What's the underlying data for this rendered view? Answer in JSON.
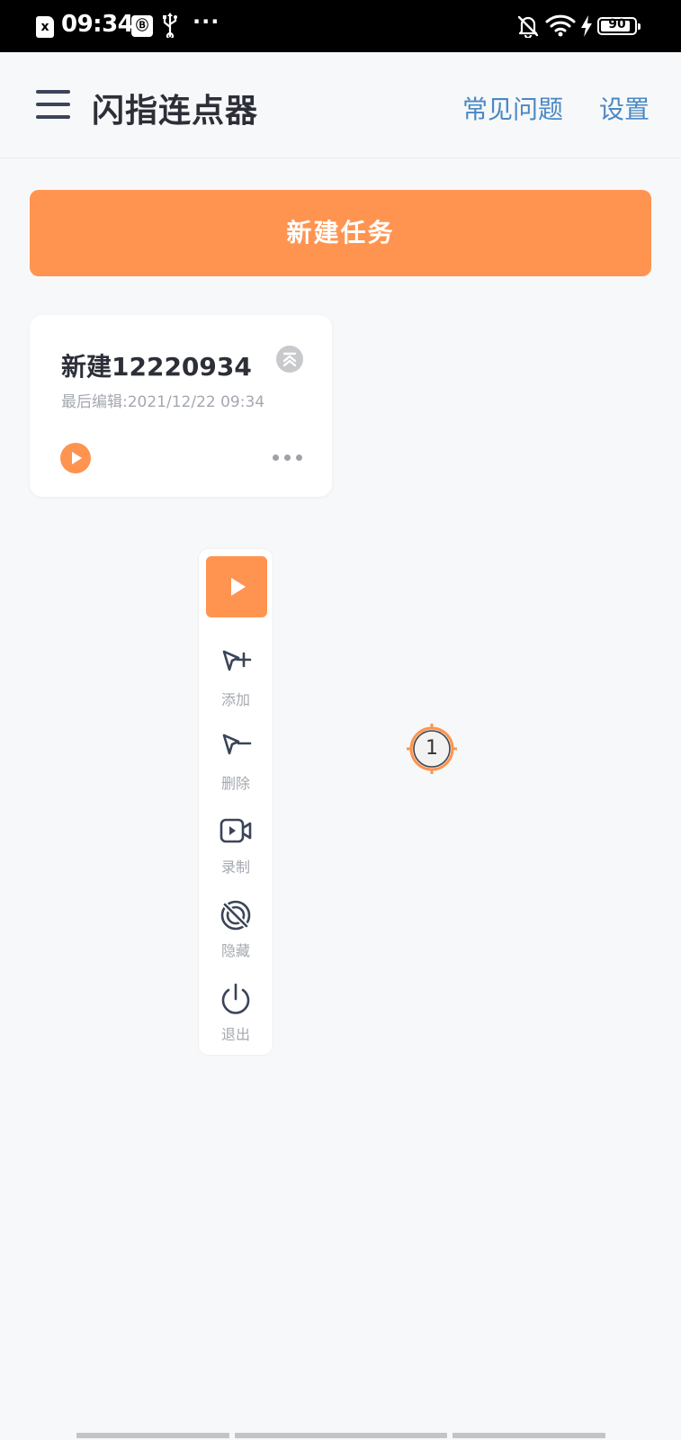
{
  "status_bar": {
    "time": "09:34",
    "sim_label": "x",
    "app_badge": "Ⓑ",
    "overflow": "···",
    "battery_level": "90",
    "battery_fraction": 0.9
  },
  "app_bar": {
    "title": "闪指连点器",
    "faq_label": "常见问题",
    "settings_label": "设置"
  },
  "new_task_label": "新建任务",
  "task": {
    "name": "新建12220934",
    "last_edit": "最后编辑:2021/12/22 09:34"
  },
  "toolbar": {
    "items": [
      {
        "label": "添加",
        "icon": "cursor-add-icon"
      },
      {
        "label": "删除",
        "icon": "cursor-remove-icon"
      },
      {
        "label": "录制",
        "icon": "record-video-icon"
      },
      {
        "label": "隐藏",
        "icon": "hide-icon"
      },
      {
        "label": "退出",
        "icon": "power-icon"
      }
    ]
  },
  "click_point": {
    "number": "1"
  },
  "colors": {
    "accent": "#ff9450",
    "link": "#4a88c4",
    "icon": "#3b4458",
    "muted_text": "#a4a8b0"
  }
}
